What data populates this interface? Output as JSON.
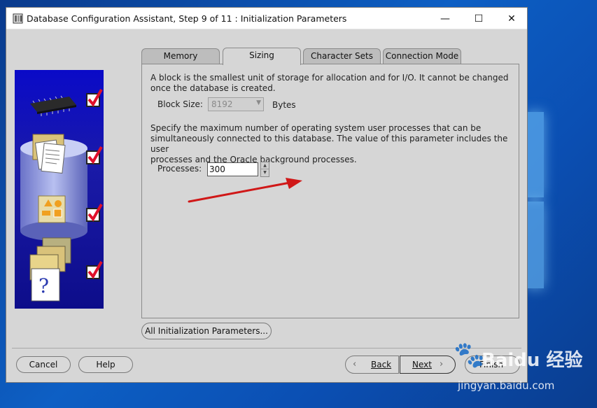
{
  "window": {
    "title": "Database Configuration Assistant, Step 9 of 11 : Initialization Parameters",
    "minimize_glyph": "—",
    "maximize_glyph": "☐",
    "close_glyph": "✕"
  },
  "tabs": [
    {
      "label": "Memory",
      "active": false
    },
    {
      "label": "Sizing",
      "active": true
    },
    {
      "label": "Character Sets",
      "active": false
    },
    {
      "label": "Connection Mode",
      "active": false
    }
  ],
  "sizing": {
    "block_description": "A block is the smallest unit of storage for allocation and for I/O. It cannot be changed once the database is created.",
    "block_line1": "A block is the smallest unit of storage for allocation and for I/O. It cannot be changed",
    "block_line2": "once the database is created.",
    "block_size_label": "Block Size:",
    "block_size_value": "8192",
    "block_size_unit": "Bytes",
    "processes_line1": "Specify the maximum number of operating system user processes that can be",
    "processes_line2": "simultaneously connected to this database. The value of this parameter includes the user",
    "processes_line3": "processes and the Oracle background processes.",
    "processes_label": "Processes:",
    "processes_value": "300"
  },
  "buttons": {
    "all_params": "All Initialization Parameters...",
    "cancel": "Cancel",
    "help": "Help",
    "back": "Back",
    "next": "Next",
    "finish": "Finish"
  },
  "watermark": {
    "brand": "Baidu 经验",
    "url": "jingyan.baidu.com"
  },
  "colors": {
    "window_bg": "#d6d6d6",
    "arrow": "#d01818",
    "side_blue": "#0a0ac8",
    "checkmark": "#e0102a"
  }
}
